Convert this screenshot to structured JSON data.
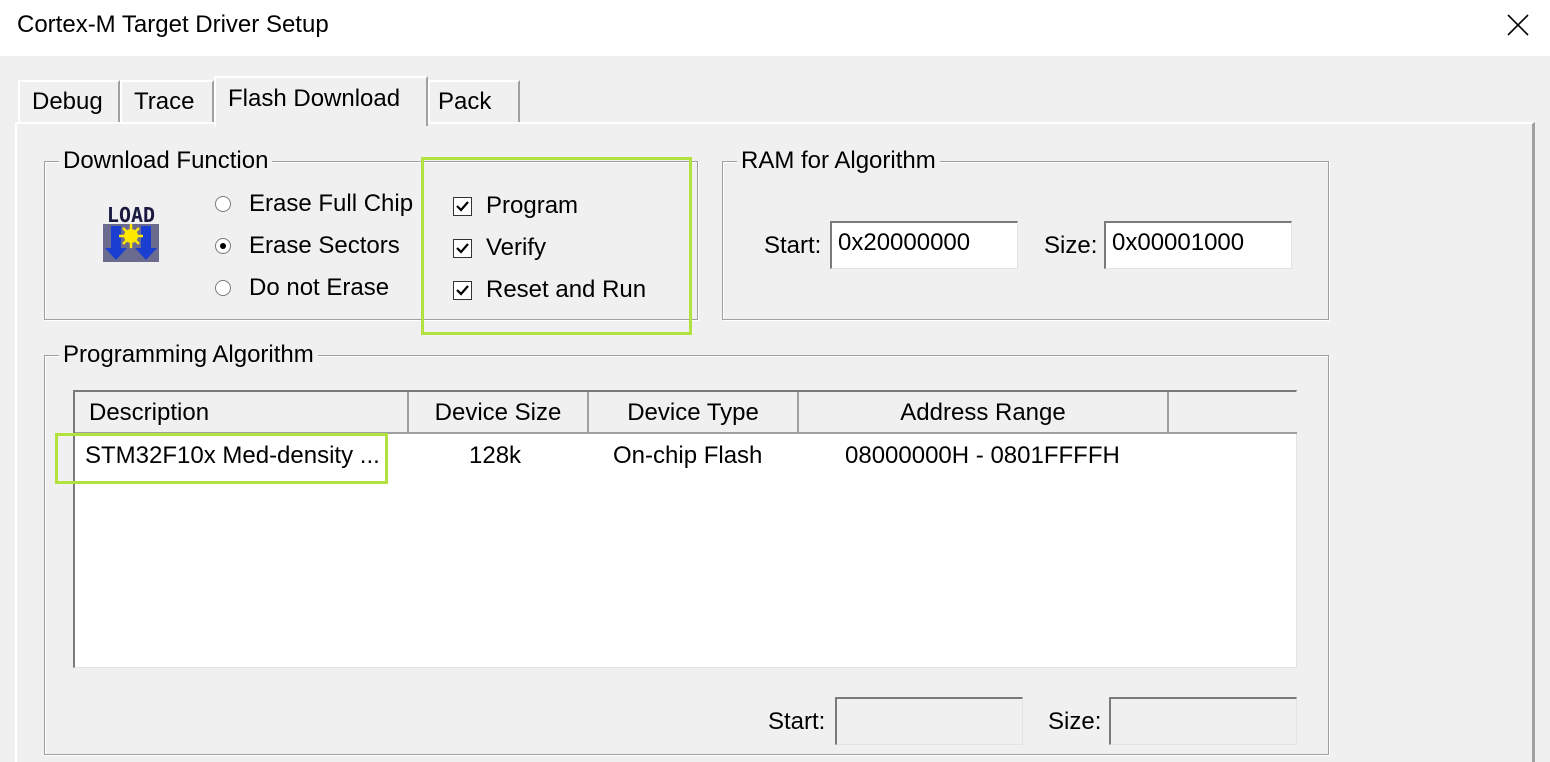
{
  "window": {
    "title": "Cortex-M Target Driver Setup",
    "close_icon": "close-icon"
  },
  "tabs": [
    {
      "label": "Debug",
      "active": false
    },
    {
      "label": "Trace",
      "active": false
    },
    {
      "label": "Flash Download",
      "active": true
    },
    {
      "label": "Pack",
      "active": false
    }
  ],
  "download_function": {
    "title": "Download Function",
    "icon": "load-icon",
    "icon_text": "LOAD",
    "erase_options": [
      {
        "label": "Erase Full Chip",
        "selected": false
      },
      {
        "label": "Erase Sectors",
        "selected": true
      },
      {
        "label": "Do not Erase",
        "selected": false
      }
    ],
    "checks": [
      {
        "label": "Program",
        "checked": true
      },
      {
        "label": "Verify",
        "checked": true
      },
      {
        "label": "Reset and Run",
        "checked": true
      }
    ]
  },
  "ram_for_algorithm": {
    "title": "RAM for Algorithm",
    "start_label": "Start:",
    "start_value": "0x20000000",
    "size_label": "Size:",
    "size_value": "0x00001000"
  },
  "programming_algorithm": {
    "title": "Programming Algorithm",
    "columns": [
      "Description",
      "Device Size",
      "Device Type",
      "Address Range"
    ],
    "rows": [
      {
        "description": "STM32F10x Med-density ...",
        "device_size": "128k",
        "device_type": "On-chip Flash",
        "address_range": "08000000H - 0801FFFFH"
      }
    ],
    "start_label": "Start:",
    "start_value": "",
    "size_label": "Size:",
    "size_value": ""
  },
  "annotation_color": "#b3e23f"
}
